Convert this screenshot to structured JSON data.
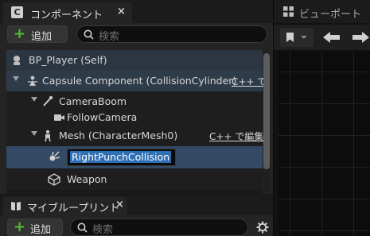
{
  "components_panel": {
    "tab_label": "コンポーネント",
    "tab_icon": "C",
    "tab_close": "×",
    "add_button_plus": "+",
    "add_button_label": "追加",
    "search_placeholder": "検索",
    "tree": [
      {
        "label": "BP_Player (Self)",
        "icon": "actor-icon"
      },
      {
        "label": "Capsule Component (CollisionCylinder)",
        "icon": "capsule-icon",
        "cpp": "C++ で"
      },
      {
        "label": "CameraBoom",
        "icon": "spring-arm-icon"
      },
      {
        "label": "FollowCamera",
        "icon": "camera-icon"
      },
      {
        "label": "Mesh (CharacterMesh0)",
        "icon": "skeletal-mesh-icon",
        "cpp": "C++ で編集"
      },
      {
        "label": "RightPunchCollision",
        "icon": "collision-icon",
        "editing": true
      },
      {
        "label": "Weapon",
        "icon": "static-mesh-icon"
      }
    ]
  },
  "blueprint_panel": {
    "tab_label": "マイブループリント",
    "tab_close": "×",
    "add_button_plus": "+",
    "add_button_label": "追加",
    "search_placeholder": "検索"
  },
  "viewport_panel": {
    "tab_label": "ビューポート",
    "chevron": "⌄"
  },
  "colors": {
    "accent_blue": "#2f6fb5",
    "add_green": "#4fbf2e",
    "selected_row": "#324a63"
  }
}
